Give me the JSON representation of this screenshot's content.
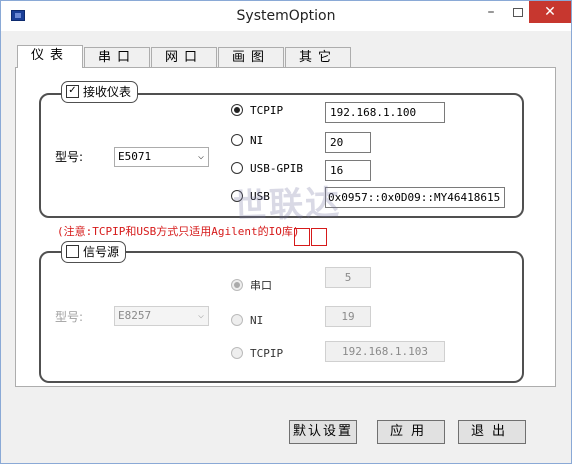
{
  "window": {
    "title": "SystemOption",
    "minimize": "–",
    "close": "✕"
  },
  "tabs": [
    "仪表",
    "串口",
    "网口",
    "画图",
    "其它"
  ],
  "receiver": {
    "legend": "接收仪表",
    "checked": true,
    "model_label": "型号:",
    "model_value": "E5071",
    "options": [
      {
        "label": "TCPIP",
        "selected": true,
        "value": "192.168.1.100"
      },
      {
        "label": "NI",
        "selected": false,
        "value": "20"
      },
      {
        "label": "USB-GPIB",
        "selected": false,
        "value": "16"
      },
      {
        "label": "USB",
        "selected": false,
        "value": "0x0957::0x0D09::MY46418615"
      }
    ]
  },
  "note": "(注意:TCPIP和USB方式只适用Agilent的IO库)",
  "source": {
    "legend": "信号源",
    "checked": false,
    "model_label": "型号:",
    "model_value": "E8257",
    "options": [
      {
        "label": "串口",
        "selected": true,
        "value": "5"
      },
      {
        "label": "NI",
        "selected": false,
        "value": "19"
      },
      {
        "label": "TCPIP",
        "selected": false,
        "value": "192.168.1.103"
      }
    ]
  },
  "watermark": "世联达",
  "buttons": {
    "default": "默认设置",
    "apply": "应用",
    "exit": "退出"
  }
}
